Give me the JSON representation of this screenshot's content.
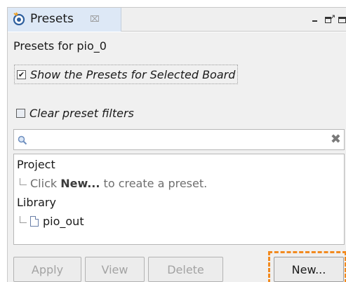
{
  "tab": {
    "title": "Presets",
    "close_glyph": "⌧",
    "icon": "presets-icon"
  },
  "view_controls": {
    "minimize_icon": "minimize-icon",
    "maximize_icon": "maximize-icon",
    "restore_icon": "restore-icon"
  },
  "panel": {
    "heading": "Presets for pio_0",
    "show_selected_board": {
      "label": "Show the Presets for Selected Board",
      "checked": true,
      "mark": "✔"
    },
    "clear_filters": {
      "label": "Clear preset filters",
      "checked": false
    },
    "search": {
      "value": "",
      "placeholder": "",
      "clear_glyph": "✖"
    },
    "tree": {
      "project_label": "Project",
      "hint_before": "Click ",
      "hint_bold": "New...",
      "hint_after": " to create a preset.",
      "library_label": "Library",
      "library_item": "pio_out"
    }
  },
  "buttons": {
    "apply": "Apply",
    "view": "View",
    "delete": "Delete",
    "new": "New..."
  },
  "colors": {
    "highlight": "#f28a1f",
    "tab_active": "#dde8f6"
  }
}
